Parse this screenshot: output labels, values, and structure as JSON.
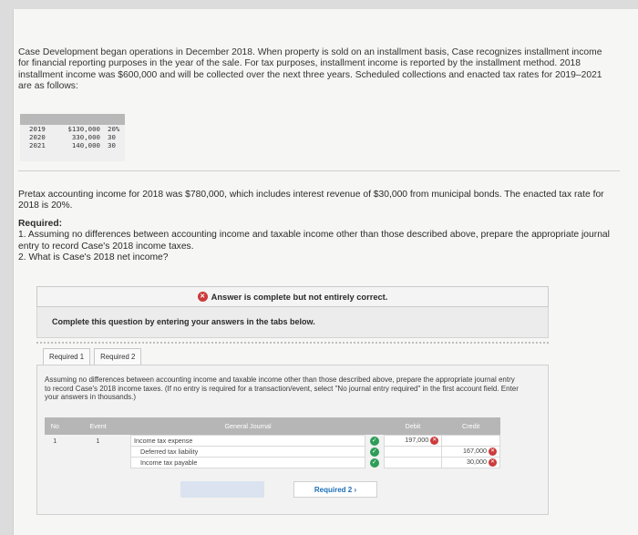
{
  "intro": "Case Development began operations in December 2018. When property is sold on an installment basis, Case recognizes installment income for financial reporting purposes in the year of the sale. For tax purposes, installment income is reported by the installment method. 2018 installment income was $600,000 and will be collected over the next three years. Scheduled collections and enacted tax rates for 2019–2021 are as follows:",
  "rates": [
    {
      "year": "2019",
      "amount": "$130,000",
      "rate": "20%"
    },
    {
      "year": "2020",
      "amount": "330,000",
      "rate": "30"
    },
    {
      "year": "2021",
      "amount": "140,000",
      "rate": "30"
    }
  ],
  "pretax": "Pretax accounting income for 2018 was $780,000, which includes interest revenue of $30,000 from municipal bonds. The enacted tax rate for 2018 is 20%.",
  "required": {
    "title": "Required:",
    "item1": "1. Assuming no differences between accounting income and taxable income other than those described above, prepare the appropriate journal entry to record Case's 2018 income taxes.",
    "item2": "2. What is Case's 2018 net income?"
  },
  "answer_status": "Answer is complete but not entirely correct.",
  "complete_instruction": "Complete this question by entering your answers in the tabs below.",
  "tabs": [
    "Required 1",
    "Required 2"
  ],
  "instructions": "Assuming no differences between accounting income and taxable income other than those described above, prepare the appropriate journal entry to record Case's 2018 income taxes. (If no entry is required for a transaction/event, select \"No journal entry required\" in the first account field. Enter your answers in thousands.)",
  "journal": {
    "headers": {
      "no": "No",
      "event": "Event",
      "journal": "General Journal",
      "debit": "Debit",
      "credit": "Credit"
    },
    "no": "1",
    "event": "1",
    "rows": [
      {
        "account": "Income tax expense",
        "debit": "197,000",
        "credit": ""
      },
      {
        "account": "Deferred tax liability",
        "debit": "",
        "credit": "167,000"
      },
      {
        "account": "Income tax payable",
        "debit": "",
        "credit": "30,000"
      }
    ]
  },
  "nav": {
    "next_label": "Required 2  ›"
  },
  "colors": {
    "accent": "#1c6fb6",
    "error": "#cc3b3b",
    "success": "#2e9d57"
  }
}
